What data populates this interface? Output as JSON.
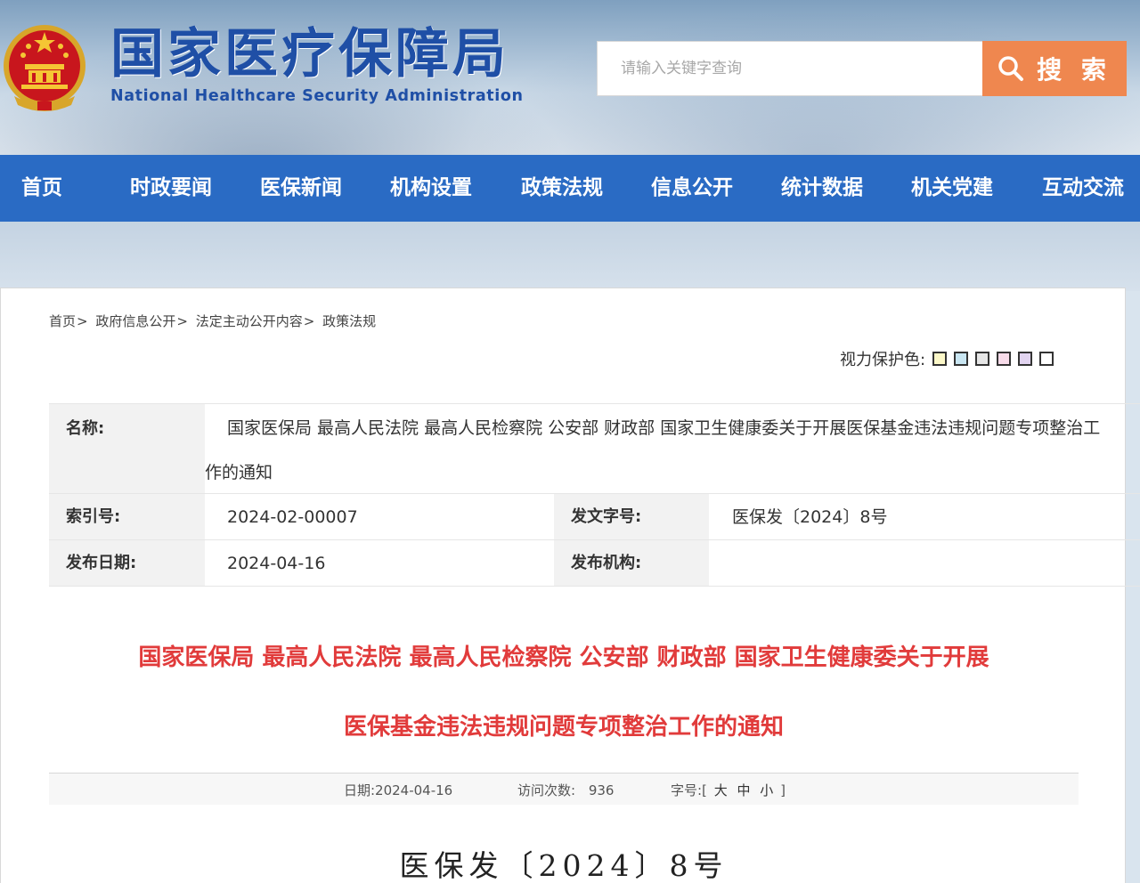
{
  "site": {
    "title": "国家医疗保障局",
    "subtitle": "National Healthcare Security Administration"
  },
  "search": {
    "placeholder": "请输入关键字查询",
    "button_label": "搜 索"
  },
  "nav": {
    "items": [
      "首页",
      "时政要闻",
      "医保新闻",
      "机构设置",
      "政策法规",
      "信息公开",
      "统计数据",
      "机关党建",
      "互动交流"
    ]
  },
  "breadcrumb": [
    "首页",
    "政府信息公开",
    "法定主动公开内容",
    "政策法规"
  ],
  "eye_protect": {
    "label": "视力保护色:",
    "colors": [
      "#fcf8c8",
      "#c9e6f2",
      "#e6e6e6",
      "#f8dcea",
      "#e2d4f0",
      "#ffffff"
    ]
  },
  "info": {
    "name_label": "名称:",
    "name_line1": "国家医保局 最高人民法院 最高人民检察院 公安部 财政部 国家卫生健康委关于开展医保基金违法违规问题专项整治工",
    "name_line2": "作的通知",
    "index_label": "索引号:",
    "index_value": "2024-02-00007",
    "doc_no_label": "发文字号:",
    "doc_no_value": "医保发〔2024〕8号",
    "date_label": "发布日期:",
    "date_value": "2024-04-16",
    "org_label": "发布机构:",
    "org_value": ""
  },
  "headline": {
    "line1": "国家医保局 最高人民法院 最高人民检察院 公安部 财政部 国家卫生健康委关于开展",
    "line2": "医保基金违法违规问题专项整治工作的通知"
  },
  "meta": {
    "date": "日期:2024-04-16",
    "visits_label": "访问次数:",
    "visits": "936",
    "font_label": "字号:[",
    "font_large": "大",
    "font_medium": "中",
    "font_small": "小",
    "font_close": "]"
  },
  "doc_number": "医保发〔2024〕8号"
}
